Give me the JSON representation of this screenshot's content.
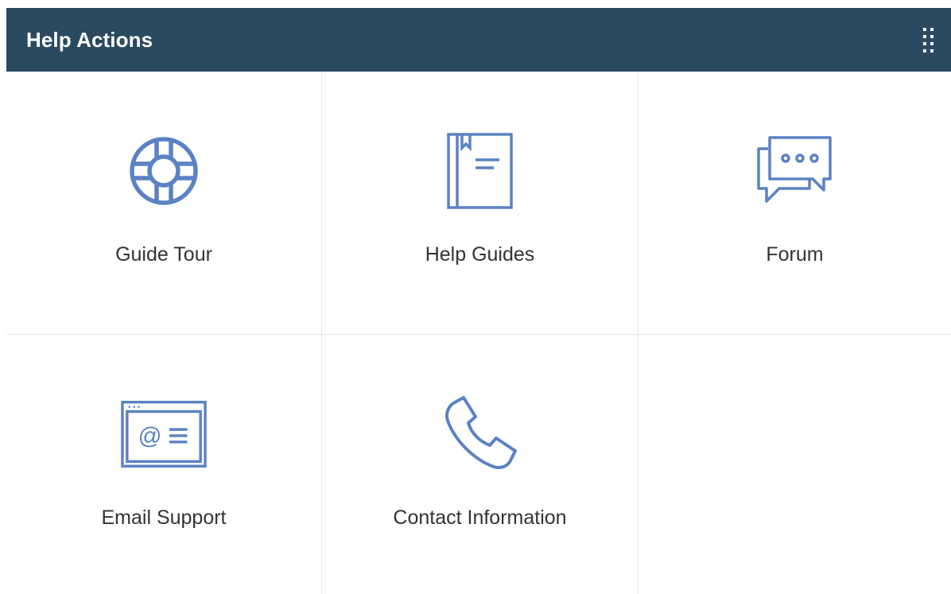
{
  "widget": {
    "title": "Help Actions",
    "accent_color": "#2a4a60",
    "icon_color": "#5b82c3"
  },
  "actions": [
    {
      "label": "Guide Tour",
      "icon": "lifebuoy-icon"
    },
    {
      "label": "Help Guides",
      "icon": "book-icon"
    },
    {
      "label": "Forum",
      "icon": "chat-bubbles-icon"
    },
    {
      "label": "Email Support",
      "icon": "email-window-icon"
    },
    {
      "label": "Contact Information",
      "icon": "phone-icon"
    }
  ]
}
